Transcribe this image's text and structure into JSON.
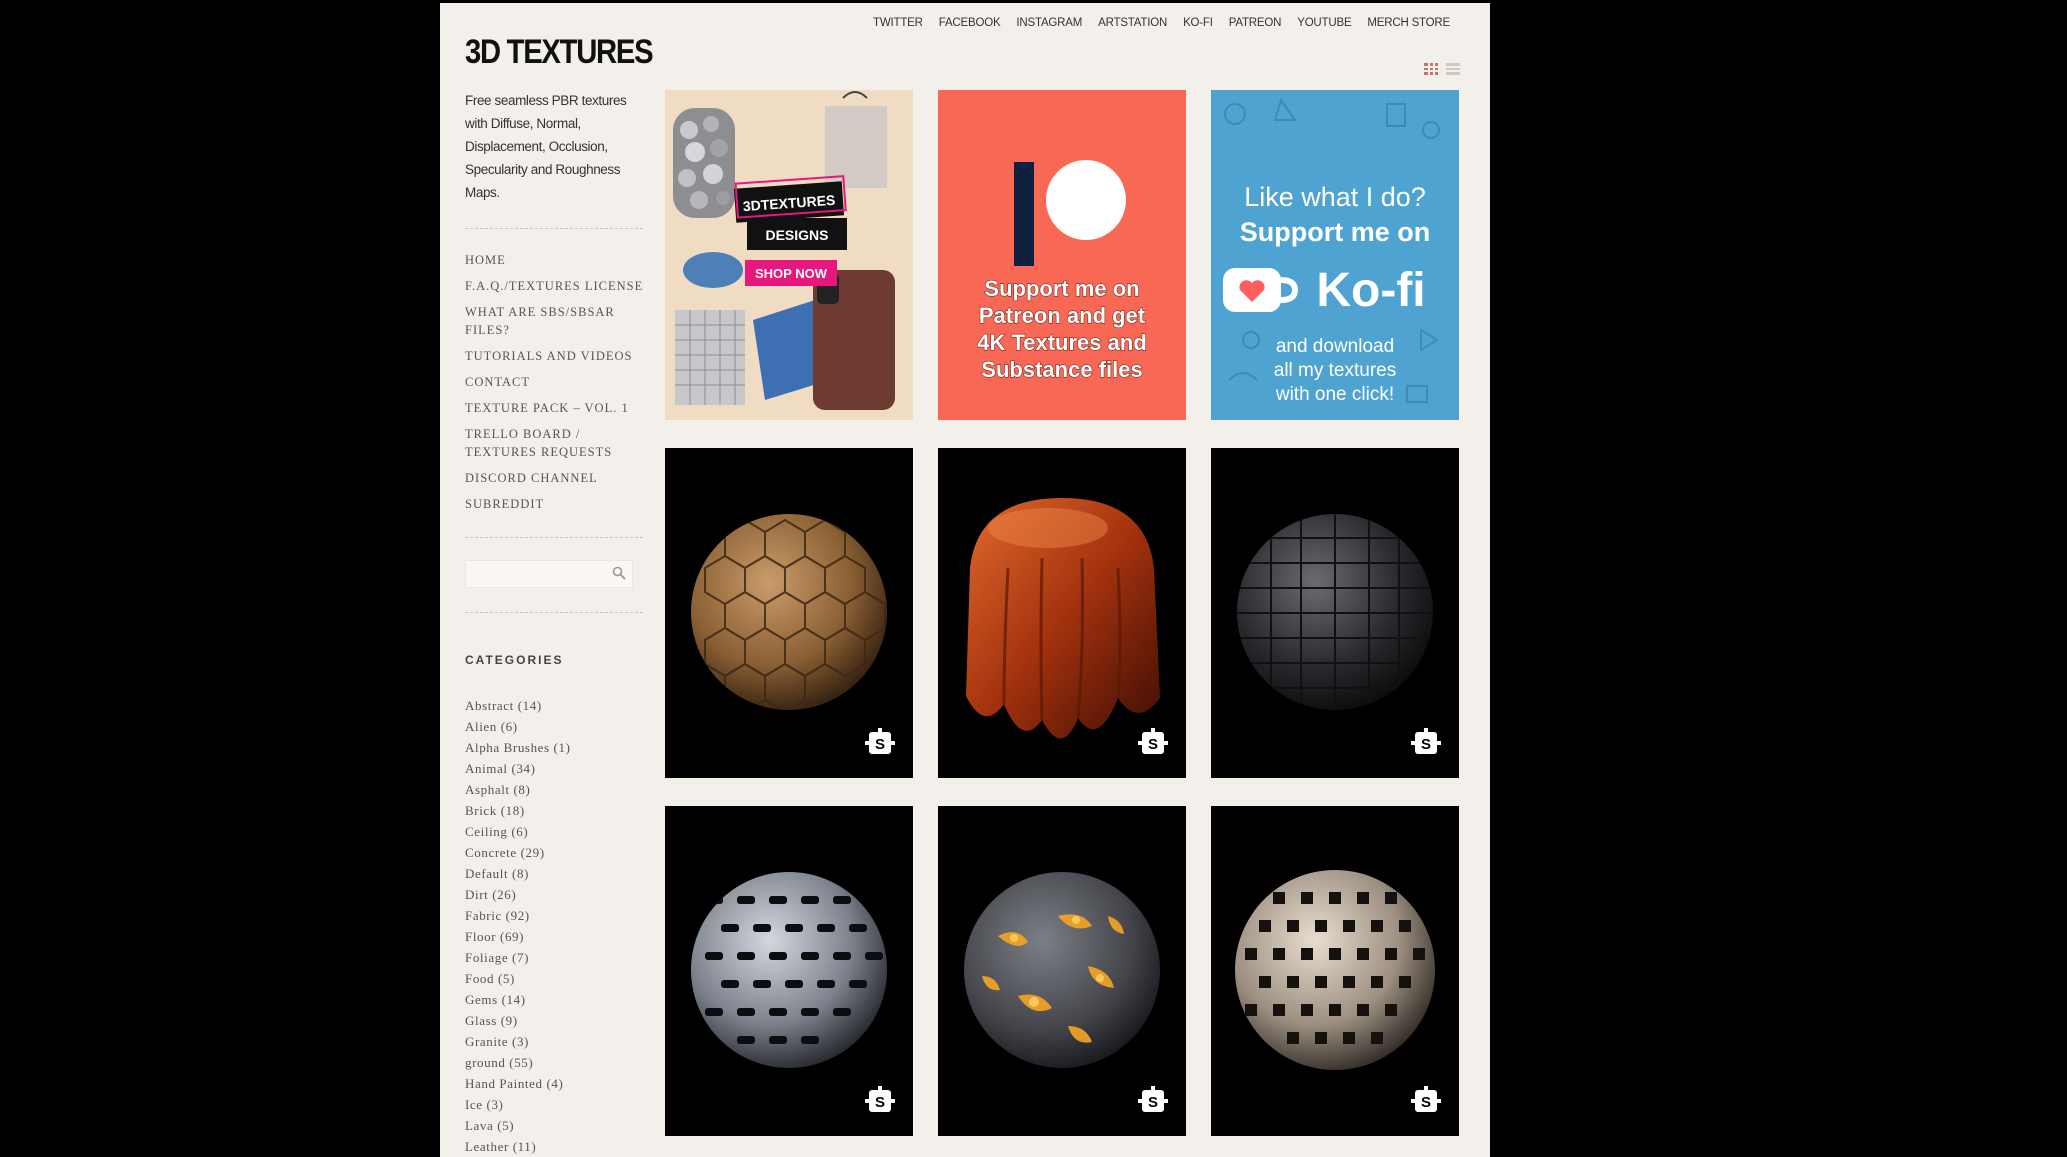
{
  "site": {
    "title": "3D TEXTURES",
    "tagline": "Free seamless PBR textures with Diffuse, Normal, Displacement, Occlusion, Specularity and Roughness Maps."
  },
  "topnav": [
    "TWITTER",
    "FACEBOOK",
    "INSTAGRAM",
    "ARTSTATION",
    "KO-FI",
    "PATREON",
    "YOUTUBE",
    "MERCH STORE"
  ],
  "menu": [
    "HOME",
    "F.A.Q./TEXTURES LICENSE",
    "WHAT ARE SBS/SBSAR FILES?",
    "TUTORIALS AND VIDEOS",
    "CONTACT",
    "TEXTURE PACK – VOL. 1",
    "TRELLO BOARD / TEXTURES REQUESTS",
    "DISCORD CHANNEL",
    "SUBREDDIT"
  ],
  "search": {
    "placeholder": ""
  },
  "categories_heading": "CATEGORIES",
  "categories": [
    "Abstract (14)",
    "Alien (6)",
    "Alpha Brushes (1)",
    "Animal (34)",
    "Asphalt (8)",
    "Brick (18)",
    "Ceiling (6)",
    "Concrete (29)",
    "Default (8)",
    "Dirt (26)",
    "Fabric (92)",
    "Floor (69)",
    "Foliage (7)",
    "Food (5)",
    "Gems (14)",
    "Glass (9)",
    "Granite (3)",
    "ground (55)",
    "Hand Painted (4)",
    "Ice (3)",
    "Lava (5)",
    "Leather (11)"
  ],
  "banners": {
    "merch": {
      "line1": "3DTEXTURES",
      "line2": "DESIGNS",
      "cta": "SHOP NOW"
    },
    "patreon": {
      "lines": [
        "Support me on",
        "Patreon and get",
        "4K Textures and",
        "Substance files"
      ]
    },
    "kofi": {
      "head1": "Like what I do?",
      "head2": "Support me on",
      "brand": "Ko-fi",
      "sub": [
        "and download",
        "all my textures",
        "with one click!"
      ]
    }
  },
  "colors": {
    "page_bg": "#f3f0ec",
    "patreon": "#f96854",
    "kofi": "#4fa3d1",
    "merch_bg": "#efdcc3",
    "accent_pink": "#e8177d"
  },
  "textures": [
    {
      "icon": "substance-icon",
      "material": "hexagon-wood-tiles"
    },
    {
      "icon": "substance-icon",
      "material": "draped-copper-fabric"
    },
    {
      "icon": "substance-icon",
      "material": "dark-woven-leather"
    },
    {
      "icon": "substance-icon",
      "material": "metal-chain-mesh"
    },
    {
      "icon": "substance-icon",
      "material": "cracked-lava-rock"
    },
    {
      "icon": "substance-icon",
      "material": "ornate-metal-lattice"
    }
  ]
}
